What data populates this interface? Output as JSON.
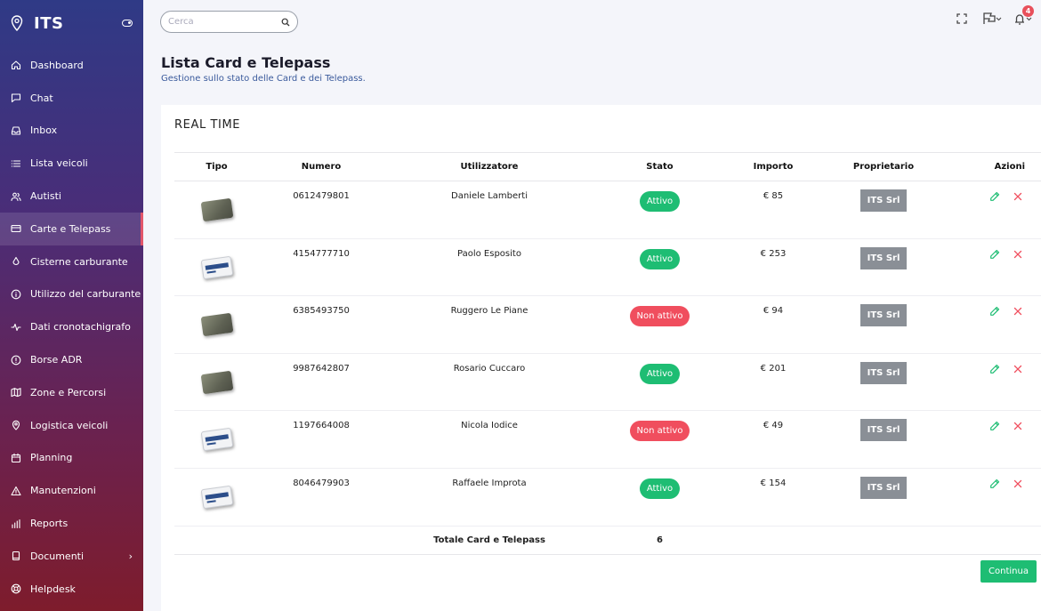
{
  "app": {
    "name": "ITS"
  },
  "sidebar": {
    "items": [
      {
        "label": "Dashboard",
        "icon": "home-icon"
      },
      {
        "label": "Chat",
        "icon": "chat-icon"
      },
      {
        "label": "Inbox",
        "icon": "inbox-icon"
      },
      {
        "label": "Lista veicoli",
        "icon": "list-icon"
      },
      {
        "label": "Autisti",
        "icon": "users-icon"
      },
      {
        "label": "Carte e Telepass",
        "icon": "card-icon",
        "active": true
      },
      {
        "label": "Cisterne carburante",
        "icon": "drop-icon"
      },
      {
        "label": "Utilizzo del carburante",
        "icon": "info-icon"
      },
      {
        "label": "Dati cronotachigrafo",
        "icon": "activity-icon"
      },
      {
        "label": "Borse ADR",
        "icon": "alert-circle-icon"
      },
      {
        "label": "Zone e Percorsi",
        "icon": "map-icon"
      },
      {
        "label": "Logistica veicoli",
        "icon": "pin-icon"
      },
      {
        "label": "Planning",
        "icon": "calendar-icon"
      },
      {
        "label": "Manutenzioni",
        "icon": "warning-icon"
      },
      {
        "label": "Reports",
        "icon": "bar-chart-icon"
      },
      {
        "label": "Documenti",
        "icon": "document-icon",
        "has_submenu": true
      },
      {
        "label": "Helpdesk",
        "icon": "lifebuoy-icon"
      }
    ]
  },
  "search": {
    "placeholder": "Cerca",
    "value": ""
  },
  "topbar": {
    "notifications_count": "4"
  },
  "page": {
    "title": "Lista Card e Telepass",
    "subtitle": "Gestione sullo stato delle Card e dei Telepass."
  },
  "card": {
    "title": "REAL TIME"
  },
  "table": {
    "headers": [
      "Tipo",
      "Numero",
      "Utilizzatore",
      "Stato",
      "Importo",
      "Proprietario",
      "Azioni"
    ],
    "rows": [
      {
        "tipo": "card",
        "numero": "0612479801",
        "utilizzatore": "Daniele Lamberti",
        "stato": "Attivo",
        "importo": "€ 85",
        "proprietario": "ITS Srl"
      },
      {
        "tipo": "telepass",
        "numero": "4154777710",
        "utilizzatore": "Paolo Esposito",
        "stato": "Attivo",
        "importo": "€ 253",
        "proprietario": "ITS Srl"
      },
      {
        "tipo": "card",
        "numero": "6385493750",
        "utilizzatore": "Ruggero Le Piane",
        "stato": "Non attivo",
        "importo": "€ 94",
        "proprietario": "ITS Srl"
      },
      {
        "tipo": "card",
        "numero": "9987642807",
        "utilizzatore": "Rosario Cuccaro",
        "stato": "Attivo",
        "importo": "€ 201",
        "proprietario": "ITS Srl"
      },
      {
        "tipo": "telepass",
        "numero": "1197664008",
        "utilizzatore": "Nicola Iodice",
        "stato": "Non attivo",
        "importo": "€ 49",
        "proprietario": "ITS Srl"
      },
      {
        "tipo": "telepass",
        "numero": "8046479903",
        "utilizzatore": "Raffaele Improta",
        "stato": "Attivo",
        "importo": "€ 154",
        "proprietario": "ITS Srl"
      }
    ],
    "total_label": "Totale Card e Telepass",
    "total_value": "6"
  },
  "buttons": {
    "next": "Continua"
  },
  "colors": {
    "active": "#1ebd73",
    "inactive": "#f04e5e",
    "accent": "#e2566a",
    "owner": "#8a8f96"
  }
}
